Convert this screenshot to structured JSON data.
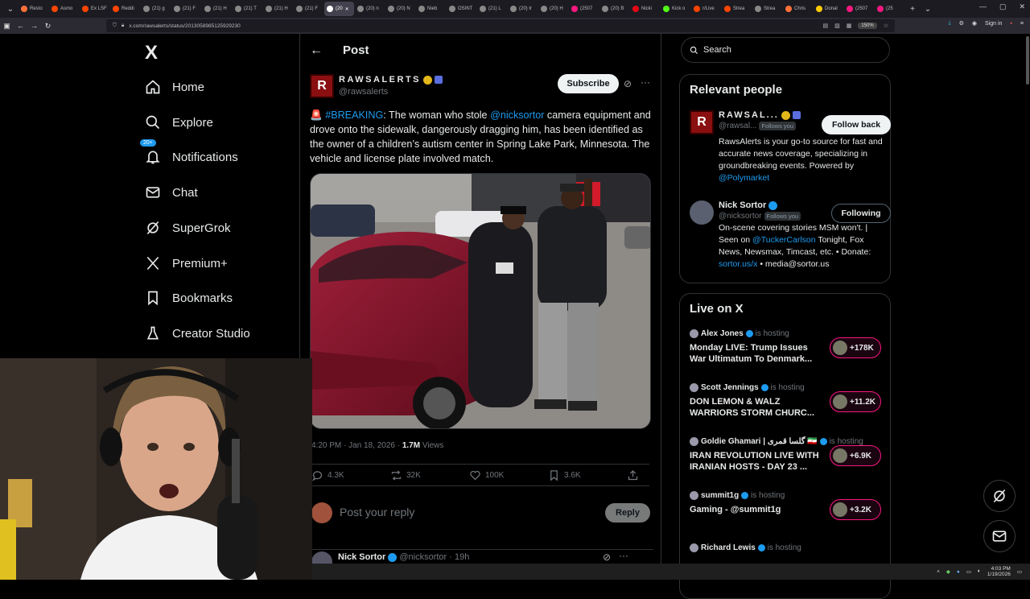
{
  "browser": {
    "tabs": [
      {
        "label": "Resto",
        "color": "#ff7139"
      },
      {
        "label": "Asmo",
        "color": "#ff4500"
      },
      {
        "label": "Ex LSF",
        "color": "#ff4500"
      },
      {
        "label": "Reddi",
        "color": "#ff4500"
      },
      {
        "label": "(21) g",
        "color": "#888888"
      },
      {
        "label": "(21) F",
        "color": "#888888"
      },
      {
        "label": "(21) H",
        "color": "#888888"
      },
      {
        "label": "(21) T",
        "color": "#888888"
      },
      {
        "label": "(21) H",
        "color": "#888888"
      },
      {
        "label": "(21) F",
        "color": "#888888"
      },
      {
        "label": "(20",
        "color": "#ffffff",
        "active": true
      },
      {
        "label": "(20) n",
        "color": "#888888"
      },
      {
        "label": "(20) N",
        "color": "#888888"
      },
      {
        "label": "Nieb",
        "color": "#888888"
      },
      {
        "label": "OSINT",
        "color": "#888888"
      },
      {
        "label": "(21) L",
        "color": "#888888"
      },
      {
        "label": "(20) tr",
        "color": "#888888"
      },
      {
        "label": "(20) H",
        "color": "#888888"
      },
      {
        "label": "(2507",
        "color": "#f91880"
      },
      {
        "label": "(20) B",
        "color": "#888888"
      },
      {
        "label": "Nicki",
        "color": "#e50914"
      },
      {
        "label": "Kick o",
        "color": "#53fc18"
      },
      {
        "label": "r/Live",
        "color": "#ff4500"
      },
      {
        "label": "Strea",
        "color": "#ff4500"
      },
      {
        "label": "Strea",
        "color": "#888888"
      },
      {
        "label": "Chris",
        "color": "#ff7139"
      },
      {
        "label": "Donal",
        "color": "#ffcc00"
      },
      {
        "label": "(2507",
        "color": "#f91880"
      },
      {
        "label": "(25",
        "color": "#f91880"
      }
    ],
    "url": "x.com/rawsalerts/status/2013058985125929230",
    "zoom": "150%",
    "signin_label": "Sign in"
  },
  "sidebar": {
    "logo": "X",
    "items": [
      {
        "label": "Home",
        "icon": "home-icon"
      },
      {
        "label": "Explore",
        "icon": "search-icon"
      },
      {
        "label": "Notifications",
        "icon": "bell-icon",
        "badge": "20+"
      },
      {
        "label": "Chat",
        "icon": "mail-icon"
      },
      {
        "label": "SuperGrok",
        "icon": "grok-icon"
      },
      {
        "label": "Premium+",
        "icon": "x-icon"
      },
      {
        "label": "Bookmarks",
        "icon": "bookmark-icon"
      },
      {
        "label": "Creator Studio",
        "icon": "flask-icon"
      }
    ]
  },
  "post": {
    "header": "Post",
    "author_name": "RAWSALERTS",
    "author_handle": "@rawsalerts",
    "subscribe_label": "Subscribe",
    "text_parts": {
      "emoji": "🚨",
      "hashtag": "#BREAKING",
      "t1": ": The woman who stole ",
      "mention": "@nicksortor",
      "t2": " camera equipment and drove onto the sidewalk, dangerously dragging him, has been identified as the owner of a children’s autism center in Spring Lake Park, Minnesota. The vehicle and license plate involved match."
    },
    "timestamp": "4:20 PM · Jan 18, 2026 · ",
    "views_count": "1.7M",
    "views_label": " Views",
    "stats": {
      "replies": "4.3K",
      "reposts": "32K",
      "likes": "100K",
      "bookmarks": "3.6K"
    },
    "reply_placeholder": "Post your reply",
    "reply_button": "Reply",
    "next_reply": {
      "name": "Nick Sortor",
      "handle": "@nicksortor",
      "time": "19h"
    }
  },
  "right": {
    "search_placeholder": "Search",
    "relevant_title": "Relevant people",
    "people": [
      {
        "name": "RAWSAL...",
        "handle": "@rawsal...",
        "follows_you": "Follows you",
        "button": "Follow back",
        "bio_pre": "RawsAlerts is your go-to source for fast and accurate news coverage, specializing in groundbreaking events. Powered by ",
        "bio_link": "@Polymarket",
        "bio_post": ""
      },
      {
        "name": "Nick Sortor",
        "handle": "@nicksortor",
        "follows_you": "Follows you",
        "button": "Following",
        "bio_pre": "On-scene covering stories MSM won't. | Seen on ",
        "bio_link": "@TuckerCarlson",
        "bio_mid": " Tonight, Fox News, Newsmax, Timcast, etc. • Donate: ",
        "bio_link2": "sortor.us/x",
        "bio_post": " • media@sortor.us"
      }
    ],
    "live_title": "Live on X",
    "live": [
      {
        "host": "Alex Jones",
        "title": "Monday LIVE: Trump Issues War Ultimatum To Denmark...",
        "count": "+178K"
      },
      {
        "host": "Scott Jennings",
        "title": "DON LEMON & WALZ WARRIORS STORM CHURC...",
        "count": "+11.2K"
      },
      {
        "host": "Goldie Ghamari | گلسا قمری 🇮🇷",
        "title": "IRAN REVOLUTION LIVE WITH IRANIAN HOSTS - DAY 23 ...",
        "count": "+6.9K"
      },
      {
        "host": "summit1g",
        "title": "Gaming - @summit1g",
        "count": "+3.2K"
      },
      {
        "host": "Richard Lewis",
        "title": "",
        "count": ""
      }
    ],
    "is_hosting": "is hosting"
  },
  "taskbar": {
    "time": "4:03 PM",
    "date": "1/19/2026"
  }
}
